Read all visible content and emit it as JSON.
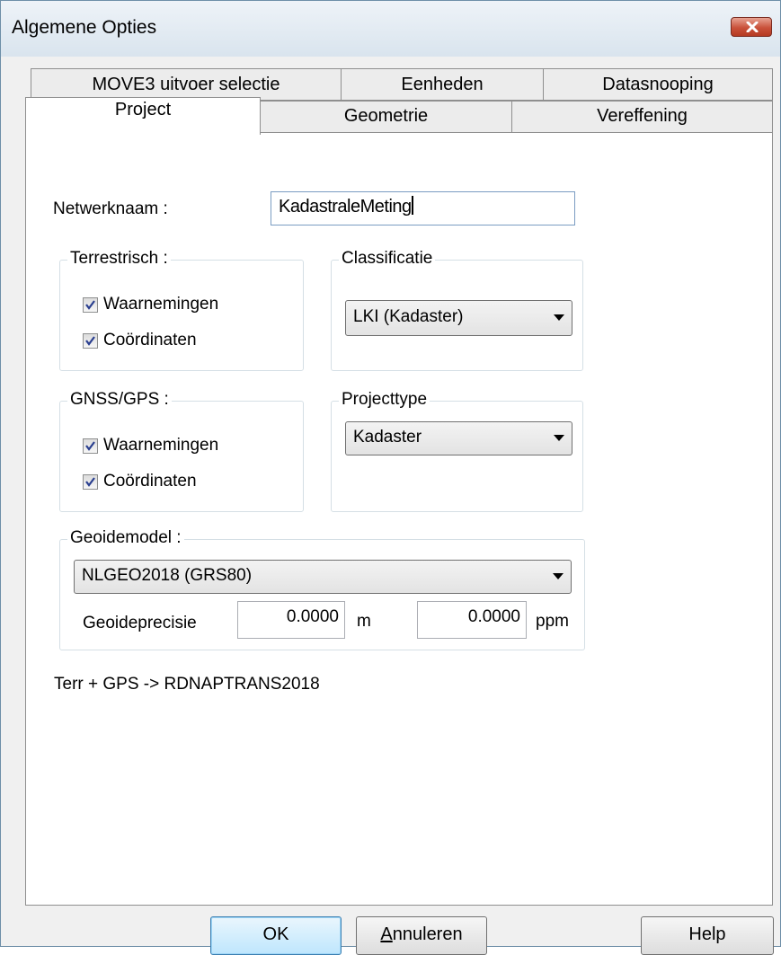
{
  "window": {
    "title": "Algemene Opties"
  },
  "tabs": {
    "back": [
      "MOVE3 uitvoer selectie",
      "Eenheden",
      "Datasnooping"
    ],
    "front": [
      "Project",
      "Geometrie",
      "Vereffening"
    ],
    "active": "Project"
  },
  "project": {
    "network_name_label": "Netwerknaam :",
    "network_name_value": "KadastraleMeting",
    "terrestrisch": {
      "label": "Terrestrisch :",
      "waarnemingen": {
        "label": "Waarnemingen",
        "checked": true
      },
      "coordinaten": {
        "label": "Coördinaten",
        "checked": true
      }
    },
    "classificatie": {
      "label": "Classificatie",
      "selected": "LKI (Kadaster)"
    },
    "gnss": {
      "label": "GNSS/GPS :",
      "waarnemingen": {
        "label": "Waarnemingen",
        "checked": true
      },
      "coordinaten": {
        "label": "Coördinaten",
        "checked": true
      }
    },
    "projecttype": {
      "label": "Projecttype",
      "selected": "Kadaster"
    },
    "geoide": {
      "label": "Geoidemodel :",
      "selected": "NLGEO2018 (GRS80)",
      "precision_label": "Geoideprecisie",
      "value_m": "0.0000",
      "unit_m": "m",
      "value_ppm": "0.0000",
      "unit_ppm": "ppm"
    },
    "transform_note": "Terr + GPS -> RDNAPTRANS2018"
  },
  "buttons": {
    "ok": "OK",
    "cancel_accel": "A",
    "cancel_rest": "nnuleren",
    "help": "Help"
  }
}
